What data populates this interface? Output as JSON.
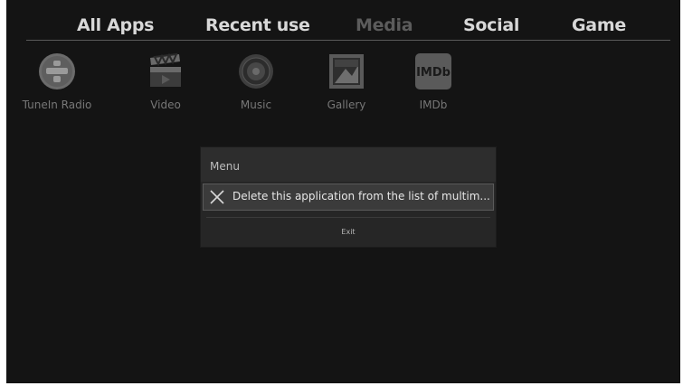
{
  "tabs": [
    {
      "label": "All Apps"
    },
    {
      "label": "Recent use"
    },
    {
      "label": "Media"
    },
    {
      "label": "Social"
    },
    {
      "label": "Game"
    }
  ],
  "active_tab": "Media",
  "apps": [
    {
      "label": "TuneIn Radio",
      "icon": "tunein-radio-icon"
    },
    {
      "label": "Video",
      "icon": "clapperboard-icon"
    },
    {
      "label": "Music",
      "icon": "speaker-icon"
    },
    {
      "label": "Gallery",
      "icon": "picture-icon"
    },
    {
      "label": "IMDb",
      "icon": "imdb-icon",
      "icon_text": "IMDb"
    }
  ],
  "dialog": {
    "title": "Menu",
    "item_label": "Delete this application from the list of multim...",
    "exit_label": "Exit"
  }
}
